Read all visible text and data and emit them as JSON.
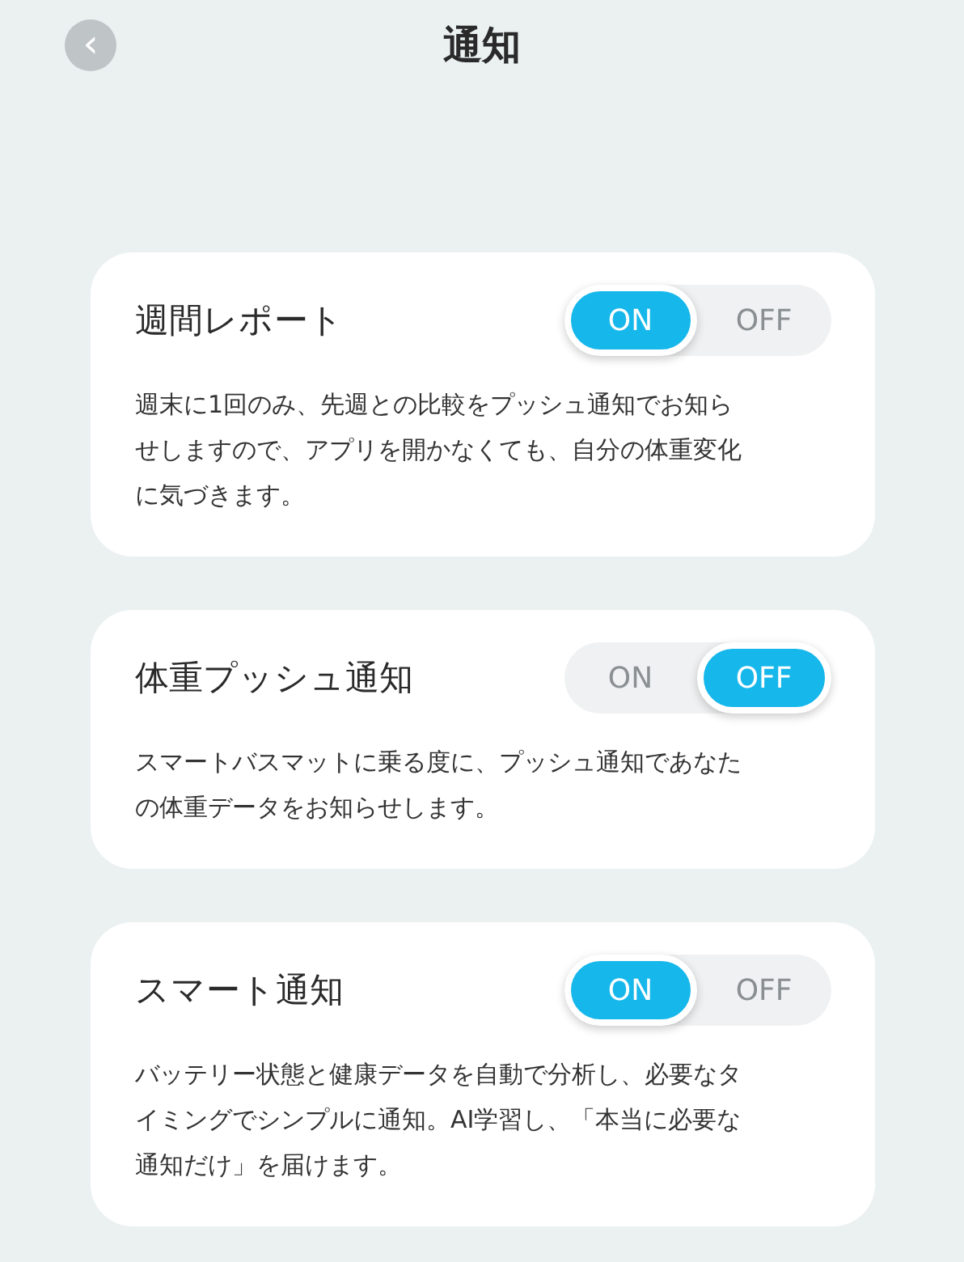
{
  "header": {
    "title": "通知",
    "back_button": "‹"
  },
  "settings": [
    {
      "title": "週間レポート",
      "description": "週末に1回のみ、先週との比較をプッシュ通知でお知らせしますので、アプリを開かなくても、自分の体重変化に気づきます。",
      "toggle": [
        {
          "label": "ON",
          "selected": true
        },
        {
          "label": "OFF",
          "selected": false
        }
      ]
    },
    {
      "title": "体重プッシュ通知",
      "description": "スマートバスマットに乗る度に、プッシュ通知であなたの体重データをお知らせします。",
      "toggle": [
        {
          "label": "ON",
          "selected": false
        },
        {
          "label": "OFF",
          "selected": true
        }
      ]
    },
    {
      "title": "スマート通知",
      "description": "バッテリー状態と健康データを自動で分析し、必要なタイミングでシンプルに通知。AI学習し、「本当に必要な通知だけ」を届けます。",
      "toggle": [
        {
          "label": "ON",
          "selected": true
        },
        {
          "label": "OFF",
          "selected": false
        }
      ]
    }
  ]
}
